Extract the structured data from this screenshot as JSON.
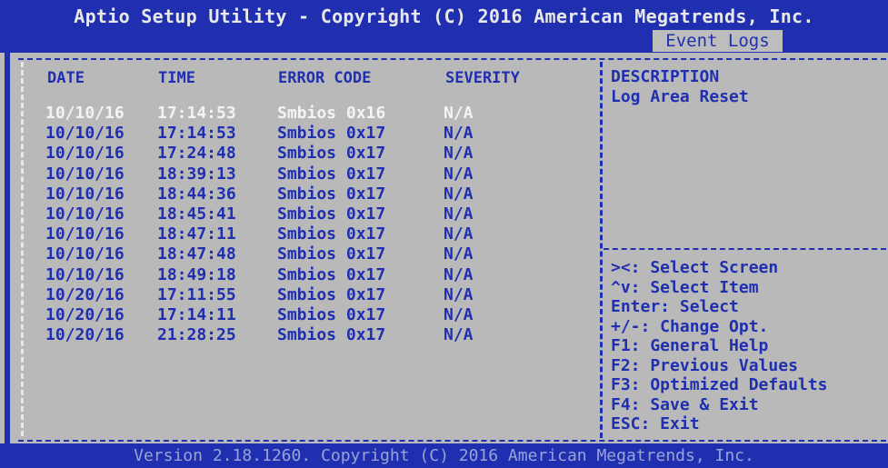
{
  "header": {
    "title": "Aptio Setup Utility - Copyright (C) 2016 American Megatrends, Inc.",
    "active_tab": "Event Logs"
  },
  "table": {
    "headers": {
      "date": "DATE",
      "time": "TIME",
      "error_code": "ERROR CODE",
      "severity": "SEVERITY"
    },
    "rows": [
      {
        "date": "10/10/16",
        "time": "17:14:53",
        "code": "Smbios 0x16",
        "severity": "N/A"
      },
      {
        "date": "10/10/16",
        "time": "17:14:53",
        "code": "Smbios 0x17",
        "severity": "N/A"
      },
      {
        "date": "10/10/16",
        "time": "17:24:48",
        "code": "Smbios 0x17",
        "severity": "N/A"
      },
      {
        "date": "10/10/16",
        "time": "18:39:13",
        "code": "Smbios 0x17",
        "severity": "N/A"
      },
      {
        "date": "10/10/16",
        "time": "18:44:36",
        "code": "Smbios 0x17",
        "severity": "N/A"
      },
      {
        "date": "10/10/16",
        "time": "18:45:41",
        "code": "Smbios 0x17",
        "severity": "N/A"
      },
      {
        "date": "10/10/16",
        "time": "18:47:11",
        "code": "Smbios 0x17",
        "severity": "N/A"
      },
      {
        "date": "10/10/16",
        "time": "18:47:48",
        "code": "Smbios 0x17",
        "severity": "N/A"
      },
      {
        "date": "10/10/16",
        "time": "18:49:18",
        "code": "Smbios 0x17",
        "severity": "N/A"
      },
      {
        "date": "10/20/16",
        "time": "17:11:55",
        "code": "Smbios 0x17",
        "severity": "N/A"
      },
      {
        "date": "10/20/16",
        "time": "17:14:11",
        "code": "Smbios 0x17",
        "severity": "N/A"
      },
      {
        "date": "10/20/16",
        "time": "21:28:25",
        "code": "Smbios 0x17",
        "severity": "N/A"
      }
    ]
  },
  "description": {
    "heading": "DESCRIPTION",
    "text": "Log Area Reset"
  },
  "help": [
    "><: Select Screen",
    "^v: Select Item",
    "Enter: Select",
    "+/-: Change Opt.",
    "F1: General Help",
    "F2: Previous Values",
    "F3: Optimized Defaults",
    "F4: Save & Exit",
    "ESC: Exit"
  ],
  "footer": {
    "text": "Version 2.18.1260. Copyright (C) 2016 American Megatrends, Inc."
  },
  "colors": {
    "bios_blue": "#1f2fb0",
    "background_gray": "#b9b9b9",
    "highlight_white": "#f4f4f4"
  }
}
